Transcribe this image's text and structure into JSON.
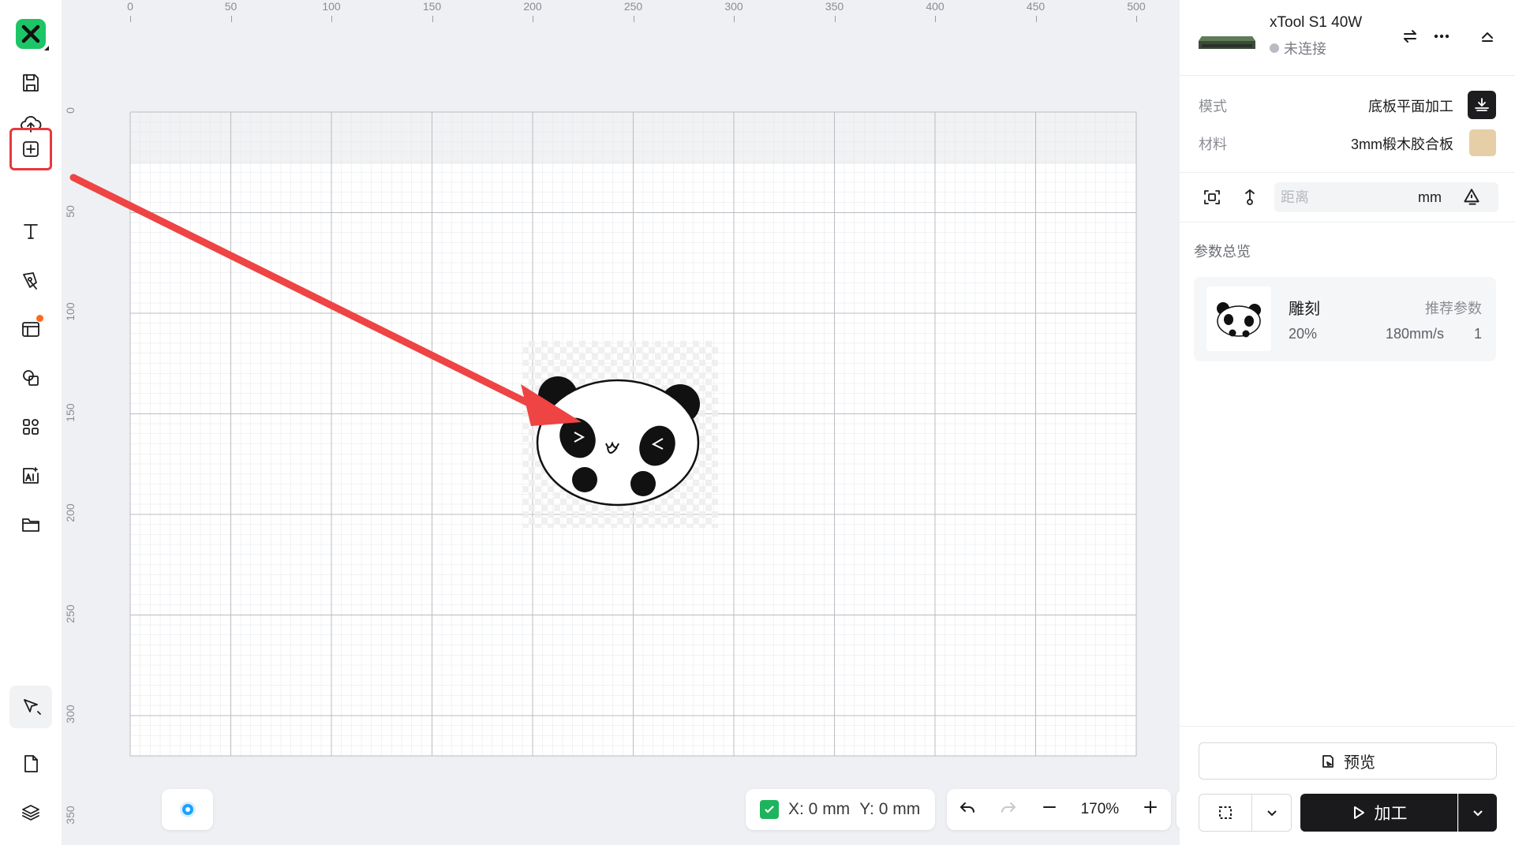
{
  "rulers": {
    "top": [
      "0",
      "50",
      "100",
      "150",
      "200",
      "250",
      "300",
      "350",
      "400",
      "450",
      "500"
    ],
    "left": [
      "0",
      "50",
      "100",
      "150",
      "200",
      "250",
      "300",
      "350"
    ]
  },
  "toolbar": {
    "items": [
      "logo",
      "save",
      "upload",
      "add-element",
      "text",
      "pen",
      "template",
      "shapes",
      "apps",
      "ai-image",
      "folder",
      "select",
      "page",
      "layers"
    ]
  },
  "device": {
    "name": "xTool S1 40W",
    "status": "未连接"
  },
  "settings": {
    "mode_label": "模式",
    "mode_value": "底板平面加工",
    "material_label": "材料",
    "material_value": "3mm椴木胶合板",
    "material_color": "#e6cfa7",
    "distance_placeholder": "距离",
    "distance_unit": "mm"
  },
  "overview": {
    "title": "参数总览",
    "card": {
      "name": "雕刻",
      "recommend": "推荐参数",
      "power": "20%",
      "speed": "180mm/s",
      "passes": "1"
    }
  },
  "footer": {
    "preview": "预览",
    "process": "加工"
  },
  "status_bar": {
    "x": "X: 0 mm",
    "y": "Y: 0 mm",
    "zoom": "170%"
  },
  "colors": {
    "brand_green": "#1ec566",
    "highlight_red": "#e8383d",
    "arrow_red": "#ee4444"
  }
}
